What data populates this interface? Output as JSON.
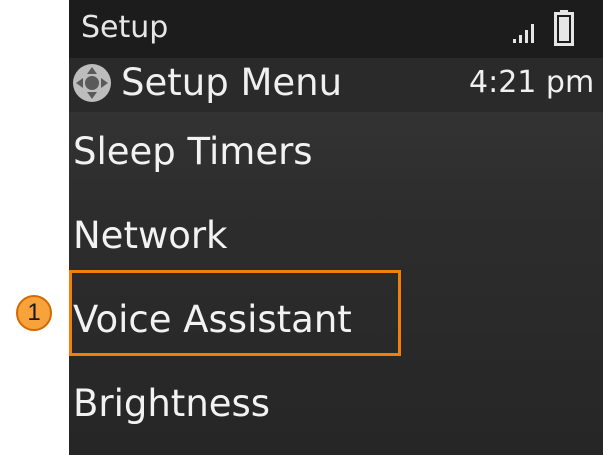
{
  "status_bar": {
    "title": "Setup",
    "signal_icon": "signal-icon",
    "battery_icon": "battery-icon"
  },
  "header": {
    "nav_icon": "dpad-navigation-icon",
    "title": "Setup Menu",
    "time": "4:21 pm"
  },
  "menu": {
    "items": [
      {
        "label": "Sleep Timers"
      },
      {
        "label": "Network"
      },
      {
        "label": "Voice Assistant",
        "highlighted": true
      },
      {
        "label": "Brightness"
      }
    ]
  },
  "callout": {
    "number": "1",
    "color": "#f07f0c"
  }
}
